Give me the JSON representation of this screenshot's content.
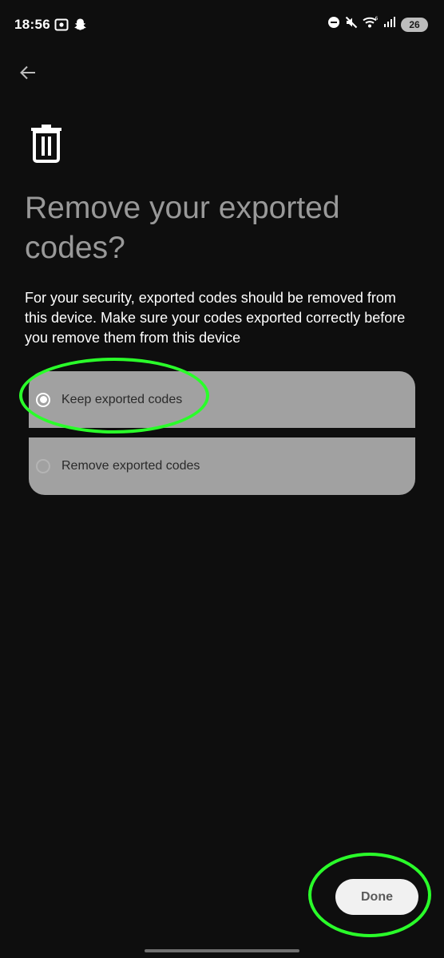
{
  "status_bar": {
    "time": "18:56",
    "battery_level": "26",
    "left_icons": [
      "screenshot-icon",
      "snapchat-icon"
    ],
    "right_icons": [
      "do-not-disturb-icon",
      "mute-icon",
      "wifi-icon",
      "signal-icon",
      "battery-icon"
    ]
  },
  "header": {
    "back_icon": "arrow-left-icon"
  },
  "main": {
    "icon": "trash-icon",
    "title": "Remove your exported codes?",
    "description": "For your security, exported codes should be removed from this device. Make sure your codes exported correctly before you remove them from this device",
    "options": [
      {
        "label": "Keep exported codes",
        "selected": true
      },
      {
        "label": "Remove exported codes",
        "selected": false
      }
    ]
  },
  "footer": {
    "done_label": "Done"
  },
  "colors": {
    "background": "#0e0e0e",
    "option_background": "#a1a1a1",
    "title_color": "#999999",
    "highlight": "#2aff2a",
    "done_button": "#f1f1f1"
  }
}
